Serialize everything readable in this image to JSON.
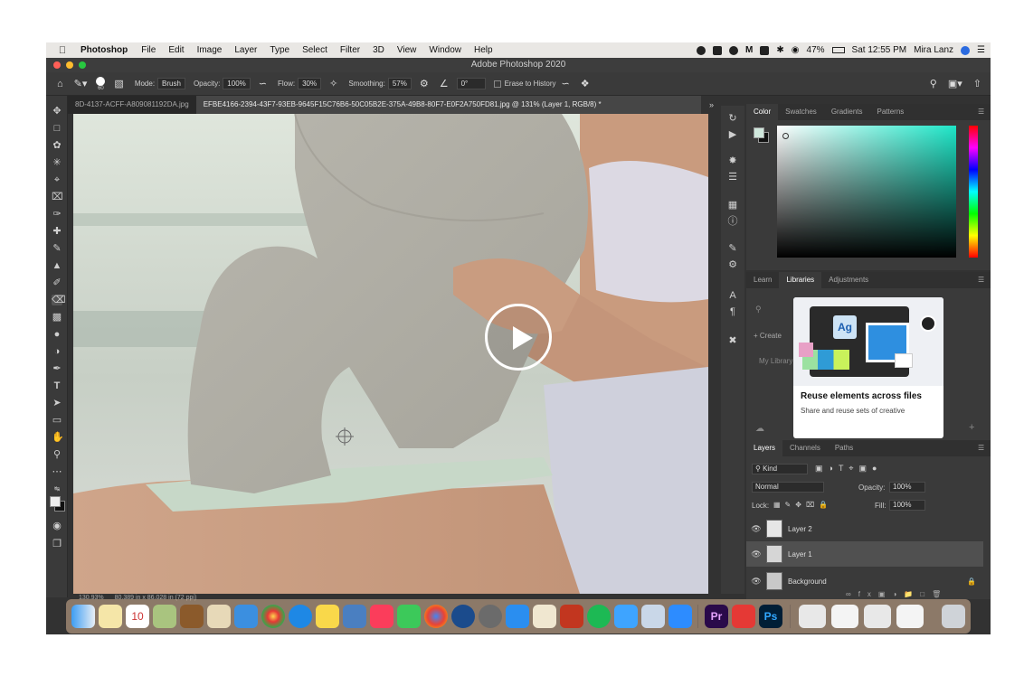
{
  "menubar": {
    "app": "Photoshop",
    "items": [
      "File",
      "Edit",
      "Image",
      "Layer",
      "Type",
      "Select",
      "Filter",
      "3D",
      "View",
      "Window",
      "Help"
    ],
    "battery": "47%",
    "clock": "Sat 12:55 PM",
    "user": "Mira Lanz"
  },
  "window": {
    "title": "Adobe Photoshop 2020"
  },
  "options": {
    "brush_size": "60",
    "mode_label": "Mode:",
    "mode_value": "Brush",
    "opacity_label": "Opacity:",
    "opacity_value": "100%",
    "flow_label": "Flow:",
    "flow_value": "30%",
    "smoothing_label": "Smoothing:",
    "smoothing_value": "57%",
    "angle_value": "0°",
    "erase_history": "Erase to History"
  },
  "tabs": [
    {
      "label": "8D-4137-ACFF-A809081192DA.jpg"
    },
    {
      "label": "EFBE4166-2394-43F7-93EB-9645F15C76B6-50C05B2E-375A-49B8-80F7-E0F2A750FD81.jpg @ 131% (Layer 1, RGB/8) *"
    }
  ],
  "color_panel": {
    "tabs": [
      "Color",
      "Swatches",
      "Gradients",
      "Patterns"
    ],
    "active": "Color",
    "gradient_color": "#1ee6c8"
  },
  "libraries_panel": {
    "tabs": [
      "Learn",
      "Libraries",
      "Adjustments"
    ],
    "active": "Libraries",
    "create_label": "+ Create",
    "my_library": "My Library",
    "promo_title": "Reuse elements across files",
    "promo_text": "Share and reuse sets of creative",
    "promo_glyph": "Ag"
  },
  "layers_panel": {
    "tabs": [
      "Layers",
      "Channels",
      "Paths"
    ],
    "active": "Layers",
    "kind_label": "Kind",
    "blend_mode": "Normal",
    "opacity_label": "Opacity:",
    "opacity_value": "100%",
    "lock_label": "Lock:",
    "fill_label": "Fill:",
    "fill_value": "100%",
    "layers": [
      {
        "name": "Layer 2",
        "selected": false
      },
      {
        "name": "Layer 1",
        "selected": true
      },
      {
        "name": "Background",
        "selected": false
      }
    ]
  },
  "status": {
    "zoom": "130.93%",
    "doc_info": "80.389 in x 86.028 in (72 ppi)"
  },
  "dock_badges": [
    "10"
  ],
  "dock_apps_right": [
    "Pr",
    "Ps"
  ]
}
